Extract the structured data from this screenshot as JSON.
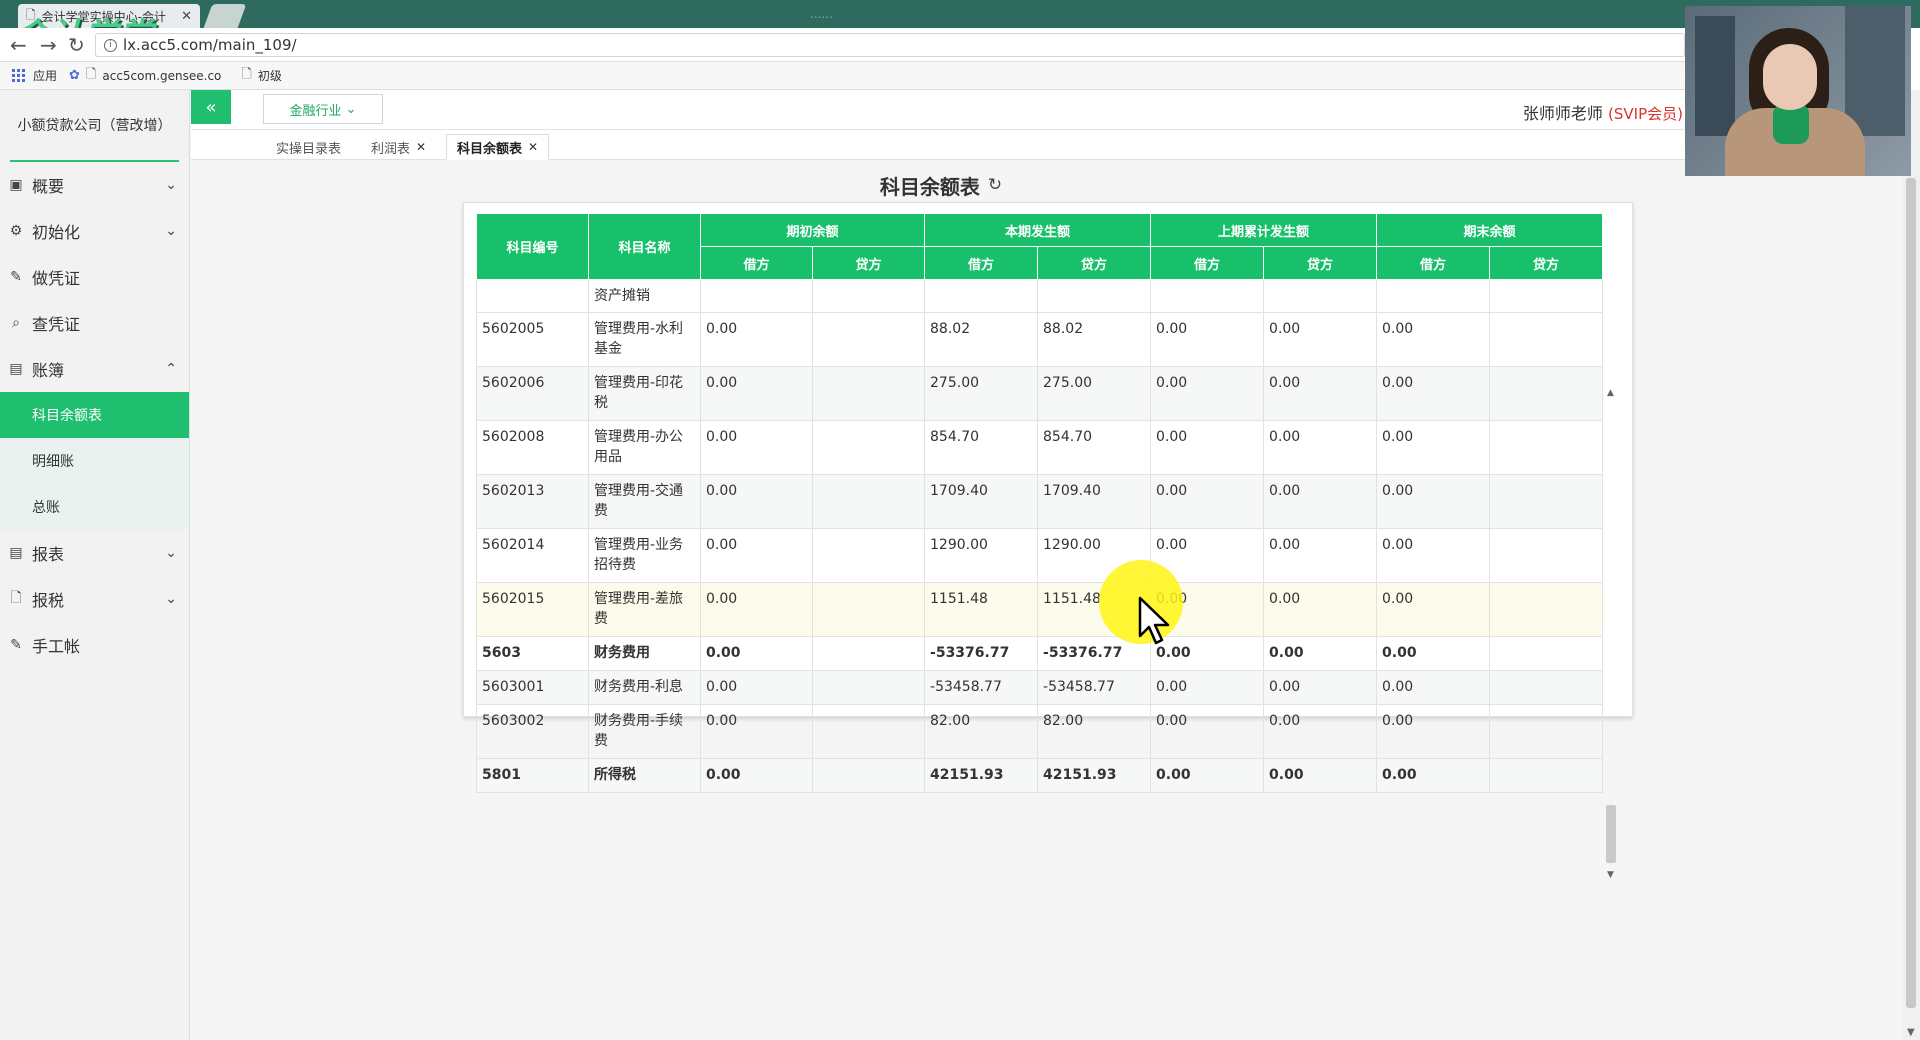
{
  "browser": {
    "tab_title": "会计学堂实操中心-会计",
    "tab_faint_title": "......",
    "url": "lx.acc5.com/main_109/",
    "bookmarks": [
      "应用",
      "acc5com.gensee.co",
      "初级"
    ]
  },
  "brand": {
    "logo_text": "会计学堂"
  },
  "sidebar": {
    "company": "小额贷款公司（营改增）",
    "items": [
      {
        "label": "概要",
        "icon": "grid-icon",
        "chevron": "down"
      },
      {
        "label": "初始化",
        "icon": "gear-icon",
        "chevron": "down"
      },
      {
        "label": "做凭证",
        "icon": "pen-icon"
      },
      {
        "label": "查凭证",
        "icon": "search-icon"
      },
      {
        "label": "账簿",
        "icon": "book-icon",
        "chevron": "up"
      },
      {
        "label": "报表",
        "icon": "report-icon",
        "chevron": "down"
      },
      {
        "label": "报税",
        "icon": "file-icon",
        "chevron": "down"
      },
      {
        "label": "手工帐",
        "icon": "pen-icon"
      }
    ],
    "sub_items": [
      "科目余额表",
      "明细账",
      "总账"
    ]
  },
  "topbar": {
    "collapse_glyph": "«",
    "industry": "金融行业",
    "user": "张师师老师",
    "vip": "(SVIP会员)"
  },
  "page_tabs": [
    "实操目录表",
    "利润表",
    "科目余额表"
  ],
  "page": {
    "title": "科目余额表"
  },
  "table": {
    "headers": {
      "code": "科目编号",
      "name": "科目名称",
      "groups": [
        "期初余额",
        "本期发生额",
        "上期累计发生额",
        "期末余额"
      ],
      "debit": "借方",
      "credit": "贷方"
    },
    "rows": [
      {
        "code": "",
        "name": "资产摊销",
        "open_d": "",
        "open_c": "",
        "cur_d": "",
        "cur_c": "",
        "prev_d": "",
        "prev_c": "",
        "end_d": "",
        "end_c": ""
      },
      {
        "code": "5602005",
        "name": "管理费用-水利基金",
        "open_d": "0.00",
        "open_c": "",
        "cur_d": "88.02",
        "cur_c": "88.02",
        "prev_d": "0.00",
        "prev_c": "0.00",
        "end_d": "0.00",
        "end_c": ""
      },
      {
        "code": "5602006",
        "name": "管理费用-印花税",
        "open_d": "0.00",
        "open_c": "",
        "cur_d": "275.00",
        "cur_c": "275.00",
        "prev_d": "0.00",
        "prev_c": "0.00",
        "end_d": "0.00",
        "end_c": ""
      },
      {
        "code": "5602008",
        "name": "管理费用-办公用品",
        "open_d": "0.00",
        "open_c": "",
        "cur_d": "854.70",
        "cur_c": "854.70",
        "prev_d": "0.00",
        "prev_c": "0.00",
        "end_d": "0.00",
        "end_c": ""
      },
      {
        "code": "5602013",
        "name": "管理费用-交通费",
        "open_d": "0.00",
        "open_c": "",
        "cur_d": "1709.40",
        "cur_c": "1709.40",
        "prev_d": "0.00",
        "prev_c": "0.00",
        "end_d": "0.00",
        "end_c": ""
      },
      {
        "code": "5602014",
        "name": "管理费用-业务招待费",
        "open_d": "0.00",
        "open_c": "",
        "cur_d": "1290.00",
        "cur_c": "1290.00",
        "prev_d": "0.00",
        "prev_c": "0.00",
        "end_d": "0.00",
        "end_c": ""
      },
      {
        "code": "5602015",
        "name": "管理费用-差旅费",
        "open_d": "0.00",
        "open_c": "",
        "cur_d": "1151.48",
        "cur_c": "1151.48",
        "prev_d": "0.00",
        "prev_c": "0.00",
        "end_d": "0.00",
        "end_c": ""
      },
      {
        "code": "5603",
        "name": "财务费用",
        "open_d": "0.00",
        "open_c": "",
        "cur_d": "-53376.77",
        "cur_c": "-53376.77",
        "prev_d": "0.00",
        "prev_c": "0.00",
        "end_d": "0.00",
        "end_c": ""
      },
      {
        "code": "5603001",
        "name": "财务费用-利息",
        "open_d": "0.00",
        "open_c": "",
        "cur_d": "-53458.77",
        "cur_c": "-53458.77",
        "prev_d": "0.00",
        "prev_c": "0.00",
        "end_d": "0.00",
        "end_c": ""
      },
      {
        "code": "5603002",
        "name": "财务费用-手续费",
        "open_d": "0.00",
        "open_c": "",
        "cur_d": "82.00",
        "cur_c": "82.00",
        "prev_d": "0.00",
        "prev_c": "0.00",
        "end_d": "0.00",
        "end_c": ""
      },
      {
        "code": "5801",
        "name": "所得税",
        "open_d": "0.00",
        "open_c": "",
        "cur_d": "42151.93",
        "cur_c": "42151.93",
        "prev_d": "0.00",
        "prev_c": "0.00",
        "end_d": "0.00",
        "end_c": ""
      }
    ]
  },
  "colors": {
    "accent": "#1fbf6f",
    "header_green": "#19c06b",
    "vip_red": "#d9332e"
  }
}
